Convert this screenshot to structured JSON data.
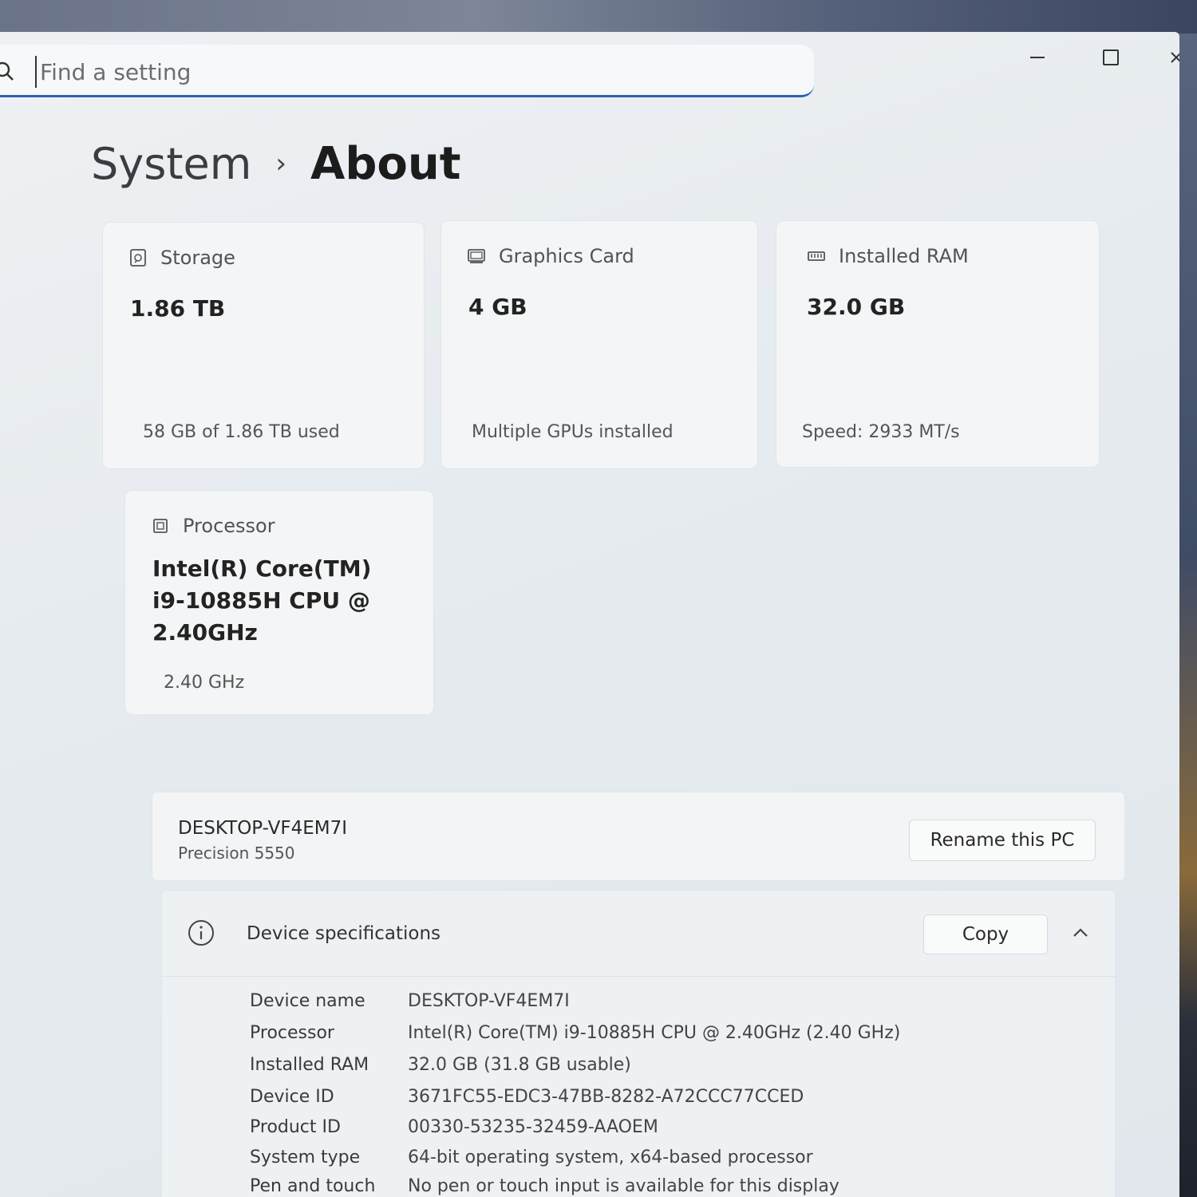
{
  "search": {
    "placeholder": "Find a setting"
  },
  "breadcrumb": {
    "parent": "System",
    "separator": "›",
    "current": "About"
  },
  "cards": {
    "storage": {
      "title": "Storage",
      "value": "1.86 TB",
      "sub": "58 GB of 1.86 TB used",
      "icon": "storage-icon"
    },
    "graphics": {
      "title": "Graphics Card",
      "value": "4 GB",
      "sub": "Multiple GPUs installed",
      "icon": "graphics-card-icon"
    },
    "ram": {
      "title": "Installed RAM",
      "value": "32.0 GB",
      "sub": "Speed: 2933 MT/s",
      "icon": "ram-icon"
    },
    "processor": {
      "title": "Processor",
      "value_line1": "Intel(R) Core(TM)",
      "value_line2": "i9-10885H CPU @",
      "value_line3": "2.40GHz",
      "sub": "2.40 GHz",
      "icon": "processor-icon"
    }
  },
  "pc": {
    "name": "DESKTOP-VF4EM7I",
    "model": "Precision 5550",
    "rename_label": "Rename this PC"
  },
  "specs": {
    "title": "Device specifications",
    "copy_label": "Copy",
    "rows": [
      {
        "label": "Device name",
        "value": "DESKTOP-VF4EM7I"
      },
      {
        "label": "Processor",
        "value": "Intel(R) Core(TM) i9-10885H CPU @ 2.40GHz (2.40 GHz)"
      },
      {
        "label": "Installed RAM",
        "value": "32.0 GB (31.8 GB usable)"
      },
      {
        "label": "Device ID",
        "value": "3671FC55-EDC3-47BB-8282-A72CCC77CCED"
      },
      {
        "label": "Product ID",
        "value": "00330-53235-32459-AAOEM"
      },
      {
        "label": "System type",
        "value": "64-bit operating system, x64-based processor"
      },
      {
        "label": "Pen and touch",
        "value": "No pen or touch input is available for this display"
      }
    ]
  }
}
